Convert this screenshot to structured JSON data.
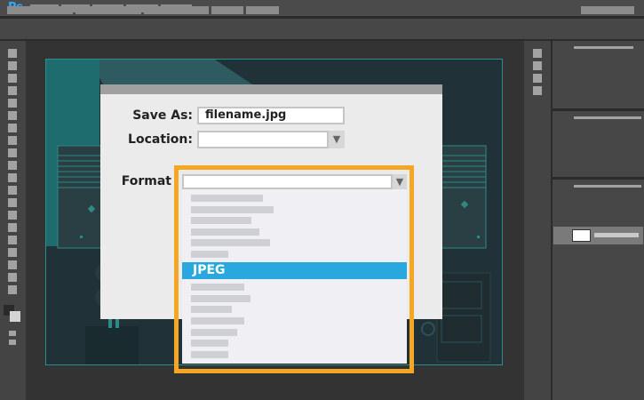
{
  "app": {
    "logo": "Ps",
    "brand_color": "#31a8ff"
  },
  "dialog": {
    "save_as_label": "Save As:",
    "filename": "filename.jpg",
    "location_label": "Location:",
    "location_value": "",
    "format_label": "Format",
    "format_value": "",
    "dropdown_arrow": "▼",
    "selected_format": "JPEG"
  },
  "colors": {
    "highlight": "#f5a623",
    "selection": "#29a8e0",
    "canvas_accent": "#2a8e8c"
  }
}
